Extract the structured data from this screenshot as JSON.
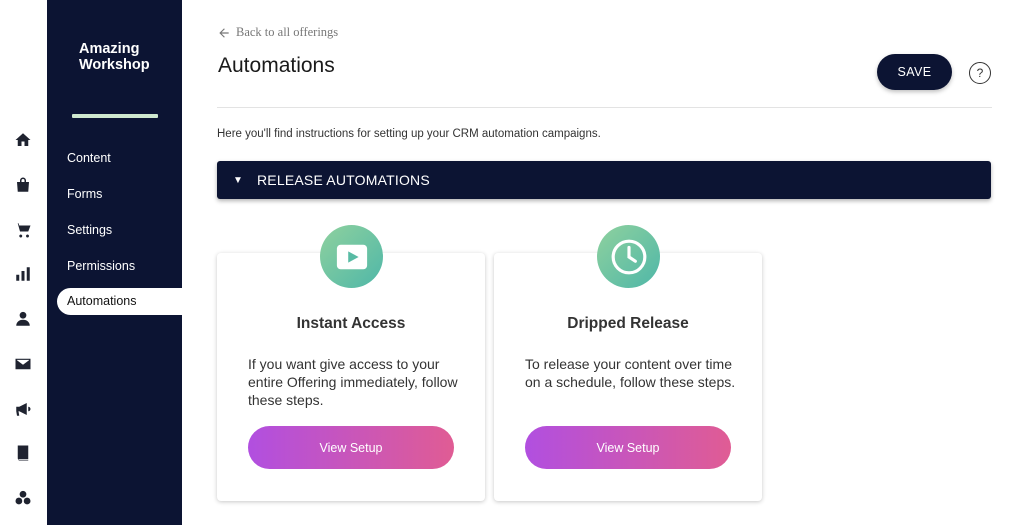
{
  "rail": {
    "icons": [
      "home-icon",
      "store-icon",
      "cart-icon",
      "bar-chart-icon",
      "user-icon",
      "mail-icon",
      "megaphone-icon",
      "book-icon",
      "community-icon"
    ]
  },
  "sidebar": {
    "brand": "Amazing Workshop",
    "items": [
      {
        "label": "Content"
      },
      {
        "label": "Forms"
      },
      {
        "label": "Settings"
      },
      {
        "label": "Permissions"
      },
      {
        "label": "Automations",
        "active": true
      }
    ]
  },
  "header": {
    "back_label": "Back to all offerings",
    "title": "Automations",
    "save_label": "SAVE",
    "help_label": "?"
  },
  "intro_text": "Here you'll find instructions for setting up your CRM automation campaigns.",
  "section": {
    "caret": "▼",
    "title": "RELEASE AUTOMATIONS"
  },
  "cards": [
    {
      "icon": "play-icon",
      "title": "Instant Access",
      "description": "If you want give access to your entire Offering immediately, follow these steps.",
      "button_label": "View Setup"
    },
    {
      "icon": "clock-icon",
      "title": "Dripped Release",
      "description": "To release your content over time on a schedule, follow these steps.",
      "button_label": "View Setup"
    }
  ],
  "colors": {
    "navy": "#0c1433",
    "accent_bar": "#cfe8cf",
    "icon_gradient_start": "#8fd19e",
    "icon_gradient_end": "#4fb7a8",
    "button_gradient_start": "#b14fe0",
    "button_gradient_end": "#e05c94"
  }
}
